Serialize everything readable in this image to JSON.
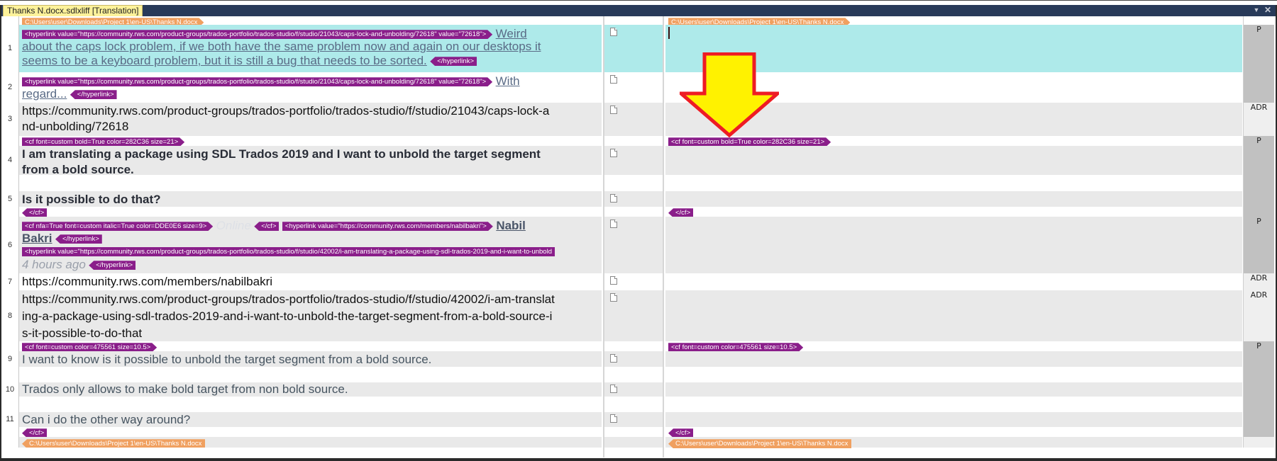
{
  "window": {
    "title": "Thanks N.docx.sdlxliff [Translation]",
    "dropdown_icon": "▼",
    "close_icon": "✕"
  },
  "file_tag": "C:\\Users\\user\\Downloads\\Project 1\\en-US\\Thanks N.docx",
  "tags": {
    "hyperlink_72618": "<hyperlink value=\"https://community.rws.com/product-groups/trados-portfolio/trados-studio/f/studio/21043/caps-lock-and-unbolding/72618\" value=\"72618\">",
    "hyperlink_close": "</hyperlink>",
    "cf_bold": "<cf font=custom bold=True color=282C36 size=21>",
    "cf_close": "</cf>",
    "cf_online": "<cf nfa=True font=custom italic=True color=DDE0E6 size=9>",
    "hyperlink_member": "<hyperlink value=\"https://community.rws.com/members/nabilbakri\">",
    "hyperlink_42002": "<hyperlink value=\"https://community.rws.com/product-groups/trados-portfolio/trados-studio/f/studio/42002/i-am-translating-a-package-using-sdl-trados-2019-and-i-want-to-unbold",
    "cf_normal": "<cf font=custom color=475561 size=10.5>"
  },
  "segments": [
    {
      "num": "1",
      "source_text": "Weird about the caps lock problem, if we both have the same problem now and again on our desktops it seems to be a keyboard problem, but it is still a bug that needs to be sorted.",
      "source_line1_end": "Weird",
      "source_line2": "about the caps lock problem, if we both have the same problem now and again on our desktops it",
      "source_line3": "seems to be a keyboard problem, but it is still a bug that needs to be sorted.",
      "status": "P",
      "target": ""
    },
    {
      "num": "2",
      "source_line1_end": "With",
      "source_line2": "regard...",
      "status": "",
      "target": ""
    },
    {
      "num": "3",
      "source_line1": "https://community.rws.com/product-groups/trados-portfolio/trados-studio/f/studio/21043/caps-lock-a",
      "source_line2": "nd-unbolding/72618",
      "status": "ADR",
      "target": ""
    },
    {
      "num": "4",
      "source_line1": "I am translating a package using SDL Trados 2019 and I want to unbold the target segment",
      "source_line2": "from a bold source.",
      "status": "P",
      "target": ""
    },
    {
      "num": "5",
      "source_line1": "Is it possible to do that?",
      "status": "",
      "target": ""
    },
    {
      "num": "6",
      "online_text": "Online",
      "nabil": "Nabil",
      "bakri": "Bakri",
      "ago": "4 hours ago",
      "status": "P",
      "target": ""
    },
    {
      "num": "7",
      "source_line1": "https://community.rws.com/members/nabilbakri",
      "status": "ADR",
      "target": ""
    },
    {
      "num": "8",
      "source_line1": "https://community.rws.com/product-groups/trados-portfolio/trados-studio/f/studio/42002/i-am-translat",
      "source_line2": "ing-a-package-using-sdl-trados-2019-and-i-want-to-unbold-the-target-segment-from-a-bold-source-i",
      "source_line3": "s-it-possible-to-do-that",
      "status": "ADR",
      "target": ""
    },
    {
      "num": "9",
      "source_line1": "I want to know is it possible to unbold the target segment from a bold source.",
      "status": "P",
      "target": ""
    },
    {
      "num": "10",
      "source_line1": "Trados only allows to make bold target from non bold source.",
      "status": "",
      "target": ""
    },
    {
      "num": "11",
      "source_line1": "Can i do the other way around?",
      "status": "",
      "target": ""
    }
  ],
  "annotation": {
    "arrow_fill": "#fff200",
    "arrow_stroke": "#ee1c24"
  },
  "colors": {
    "active_row": "#aeeaea",
    "tag_purple": "#8a1e8a",
    "tag_orange": "#f0a060",
    "titlebar": "#283a59",
    "title_tab": "#fdf29a"
  }
}
